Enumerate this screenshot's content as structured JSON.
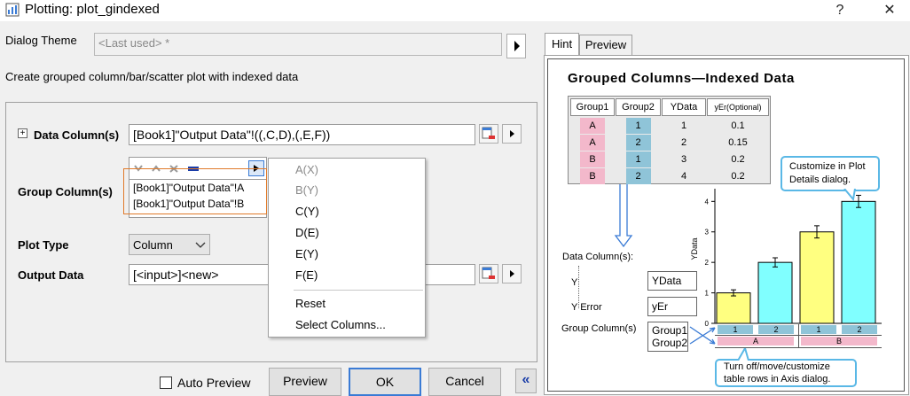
{
  "window": {
    "title": "Plotting: plot_gindexed",
    "help_glyph": "?",
    "close_glyph": "✕"
  },
  "theme": {
    "label": "Dialog Theme",
    "value": "<Last used> *"
  },
  "description": "Create grouped column/bar/scatter plot with indexed data",
  "tree_expand_glyph": "+",
  "data_column": {
    "label": "Data Column(s)",
    "value": "[Book1]\"Output Data\"!((,C,D),(,E,F))"
  },
  "group_column": {
    "label": "Group Column(s)",
    "lines": [
      "[Book1]\"Output Data\"!A",
      "[Book1]\"Output Data\"!B"
    ]
  },
  "plot_type": {
    "label": "Plot Type",
    "value": "Column"
  },
  "output_data": {
    "label": "Output Data",
    "value": "[<input>]<new>"
  },
  "context_menu": {
    "items": [
      {
        "label": "A(X)",
        "disabled": true
      },
      {
        "label": "B(Y)",
        "disabled": true
      },
      {
        "label": "C(Y)",
        "disabled": false
      },
      {
        "label": "D(E)",
        "disabled": false
      },
      {
        "label": "E(Y)",
        "disabled": false
      },
      {
        "label": "F(E)",
        "disabled": false
      },
      {
        "label": "Reset",
        "disabled": false
      },
      {
        "label": "Select Columns...",
        "disabled": false
      }
    ]
  },
  "footer": {
    "auto_preview": "Auto Preview",
    "preview": "Preview",
    "ok": "OK",
    "cancel": "Cancel",
    "collapse_glyph": "«"
  },
  "tabs": [
    {
      "label": "Hint",
      "active": true
    },
    {
      "label": "Preview",
      "active": false
    }
  ],
  "hint": {
    "title": "Grouped Columns—Indexed Data",
    "table_headers": [
      "Group1",
      "Group2",
      "YData",
      "yEr(Optional)"
    ],
    "table_rows": [
      [
        "A",
        "1",
        "1",
        "0.1"
      ],
      [
        "A",
        "2",
        "2",
        "0.15"
      ],
      [
        "B",
        "1",
        "3",
        "0.2"
      ],
      [
        "B",
        "2",
        "4",
        "0.2"
      ]
    ],
    "callout_top": [
      "Customize in Plot",
      "Details dialog."
    ],
    "callout_bottom": [
      "Turn off/move/customize",
      "table rows in Axis dialog."
    ],
    "data_columns_label": "Data Column(s):",
    "y_label": "Y",
    "y_error_label": "Y Error",
    "y_box": "YData",
    "yerr_box": "yEr",
    "group_columns_label": "Group Column(s)",
    "group_box": [
      "Group1",
      "Group2"
    ],
    "axis_table_row1": [
      "1",
      "2",
      "1",
      "2"
    ],
    "axis_table_row2": [
      "A",
      "B"
    ]
  },
  "chart_data": {
    "type": "bar",
    "categories": [
      "A-1",
      "A-2",
      "B-1",
      "B-2"
    ],
    "values": [
      1,
      2,
      3,
      4
    ],
    "errors": [
      0.1,
      0.15,
      0.2,
      0.2
    ],
    "ylabel": "YData",
    "ylim": [
      0,
      4.3
    ],
    "yticks": [
      0,
      1,
      2,
      3,
      4
    ],
    "bar_colors": [
      "#ffff80",
      "#80ffff",
      "#ffff80",
      "#80ffff"
    ]
  }
}
